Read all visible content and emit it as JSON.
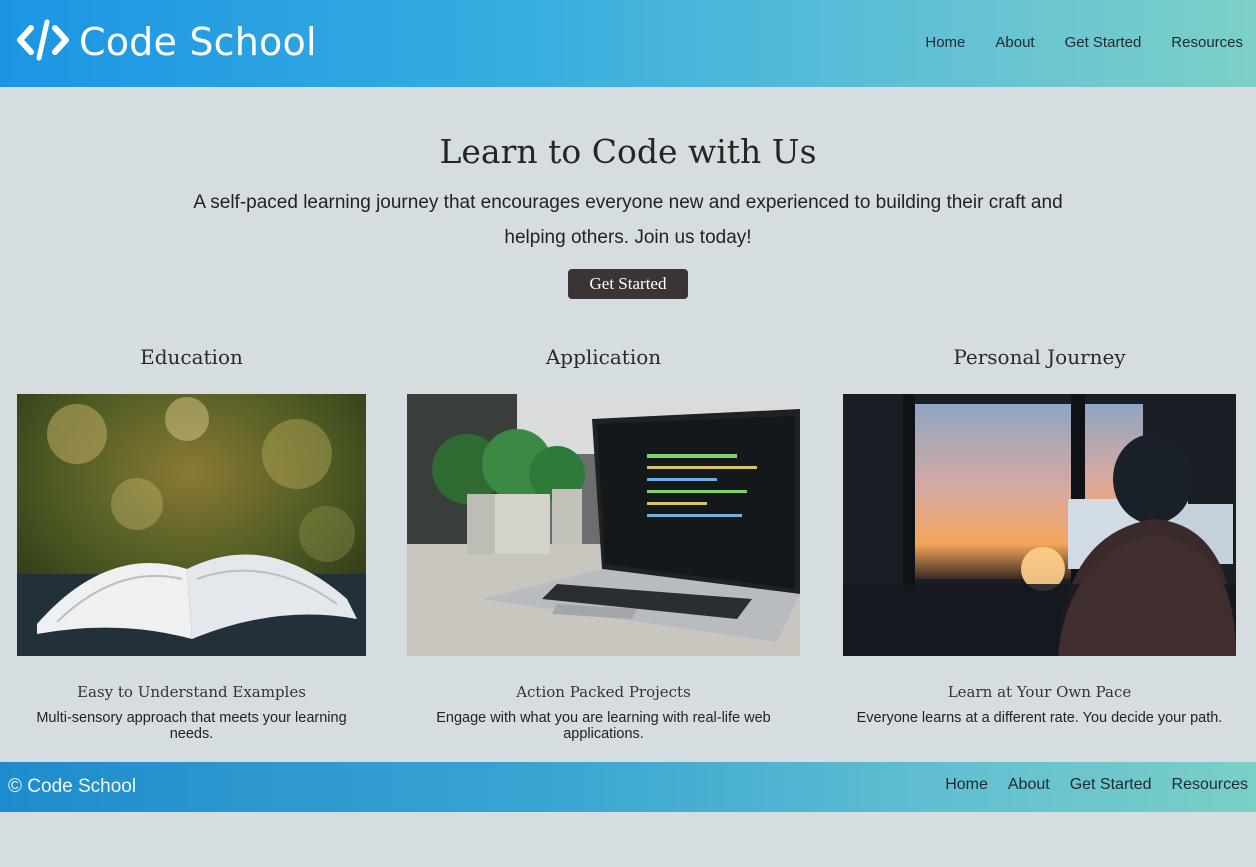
{
  "header": {
    "logo_icon": "code-brackets-icon",
    "brand": "Code School",
    "nav": [
      "Home",
      "About",
      "Get Started",
      "Resources"
    ]
  },
  "hero": {
    "title": "Learn to Code with Us",
    "description_line1": "A self-paced learning journey that encourages everyone new and experienced to building their craft and",
    "description_line2": "helping others. Join us today!",
    "cta": "Get Started"
  },
  "features": [
    {
      "title": "Education",
      "subtitle": "Easy to Understand Examples",
      "desc_line1": "Multi-sensory approach that meets your learning",
      "desc_line2": "needs."
    },
    {
      "title": "Application",
      "subtitle": "Action Packed Projects",
      "desc_line1": "Engage with what you are learning with real-life web",
      "desc_line2": "applications."
    },
    {
      "title": "Personal Journey",
      "subtitle": "Learn at Your Own Pace",
      "desc_line1": "Everyone learns at a different rate. You decide your path.",
      "desc_line2": ""
    }
  ],
  "footer": {
    "copyright": "© Code School",
    "nav": [
      "Home",
      "About",
      "Get Started",
      "Resources"
    ]
  },
  "colors": {
    "header_gradient_start": "#1c95e4",
    "header_gradient_end": "#7dd0c7",
    "page_background": "#d6dde1",
    "cta_background": "#3b3434"
  }
}
